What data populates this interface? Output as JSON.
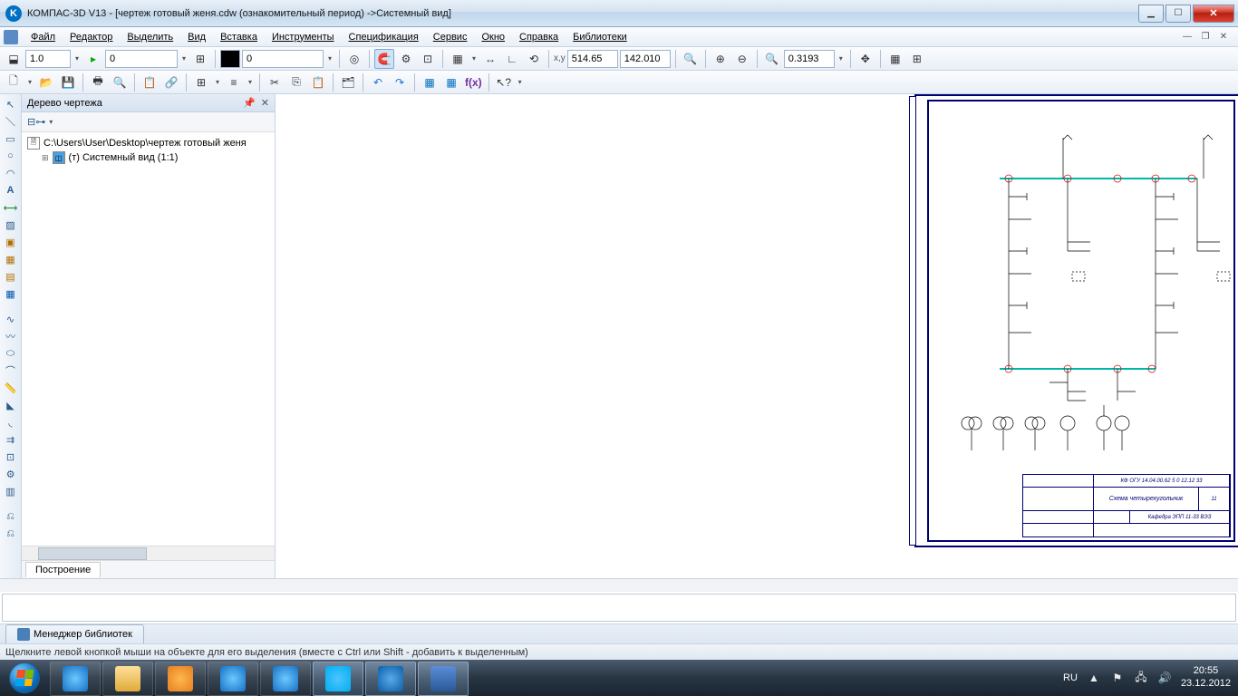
{
  "window": {
    "title": "КОМПАС-3D V13 - [чертеж готовый женя.cdw (ознакомительный период) ->Системный вид]"
  },
  "menu": {
    "items": [
      "Файл",
      "Редактор",
      "Выделить",
      "Вид",
      "Вставка",
      "Инструменты",
      "Спецификация",
      "Сервис",
      "Окно",
      "Справка",
      "Библиотеки"
    ]
  },
  "toolbars": {
    "row1": {
      "scale": "1.0",
      "layer": "0",
      "style": "0",
      "coord_x": "514.65",
      "coord_y": "142.010",
      "zoom": "0.3193"
    }
  },
  "tree": {
    "title": "Дерево чертежа",
    "file_path": "C:\\Users\\User\\Desktop\\чертеж готовый женя",
    "view_node": "(т) Системный вид (1:1)",
    "tab": "Построение"
  },
  "title_block": {
    "code": "КФ ОГУ 14.04.00.62 5 0 12.12 33",
    "name": "Схема четырехугольник",
    "dept": "Кафедра ЭПП 11-33 ВЭЗ",
    "sheet": "11"
  },
  "bottom_tabs": {
    "lib_manager": "Менеджер библиотек"
  },
  "status": {
    "hint": "Щелкните левой кнопкой мыши на объекте для его выделения (вместе с Ctrl или Shift - добавить к выделенным)"
  },
  "tray": {
    "lang": "RU",
    "time": "20:55",
    "date": "23.12.2012"
  }
}
